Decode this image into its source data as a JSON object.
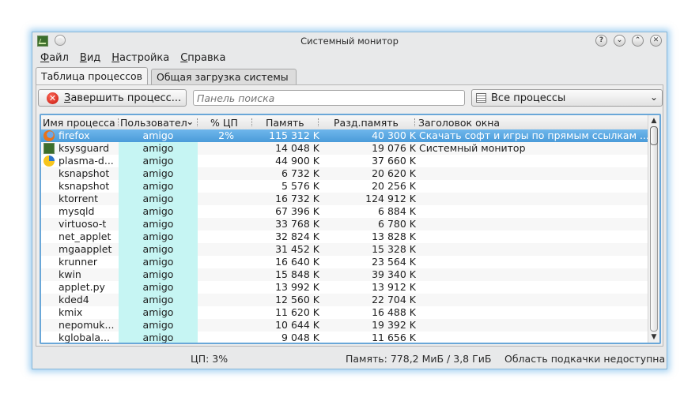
{
  "window": {
    "title": "Системный монитор",
    "buttons": [
      "?",
      "⌄",
      "⌃",
      "✕"
    ]
  },
  "menubar": [
    "Файл",
    "Вид",
    "Настройка",
    "Справка"
  ],
  "tabs": [
    {
      "label": "Таблица процессов",
      "active": true
    },
    {
      "label": "Общая загрузка системы",
      "active": false
    }
  ],
  "toolbar": {
    "kill_label": "Завершить процесс...",
    "search_placeholder": "Панель поиска",
    "filter_value": "Все процессы"
  },
  "table": {
    "columns": [
      "Имя процесса",
      "Пользовател",
      "% ЦП",
      "Память",
      "Разд.память",
      "Заголовок окна"
    ],
    "rows": [
      {
        "icon": "firefox-icon",
        "name": "firefox",
        "user": "amigo",
        "cpu": "2%",
        "mem": "115 312 K",
        "shared": "40 300 K",
        "title": "Скачать софт и игры по прямым ссылкам ..."
      },
      {
        "icon": "ksysguard-icon",
        "name": "ksysguard",
        "user": "amigo",
        "cpu": "",
        "mem": "14 048 K",
        "shared": "19 076 K",
        "title": "Системный монитор"
      },
      {
        "icon": "plasma-icon",
        "name": "plasma-d...",
        "user": "amigo",
        "cpu": "",
        "mem": "44 900 K",
        "shared": "37 660 K",
        "title": ""
      },
      {
        "icon": "",
        "name": "ksnapshot",
        "user": "amigo",
        "cpu": "",
        "mem": "6 732 K",
        "shared": "20 620 K",
        "title": ""
      },
      {
        "icon": "",
        "name": "ksnapshot",
        "user": "amigo",
        "cpu": "",
        "mem": "5 576 K",
        "shared": "20 256 K",
        "title": ""
      },
      {
        "icon": "",
        "name": "ktorrent",
        "user": "amigo",
        "cpu": "",
        "mem": "16 732 K",
        "shared": "124 912 K",
        "title": ""
      },
      {
        "icon": "",
        "name": "mysqld",
        "user": "amigo",
        "cpu": "",
        "mem": "67 396 K",
        "shared": "6 884 K",
        "title": ""
      },
      {
        "icon": "",
        "name": "virtuoso-t",
        "user": "amigo",
        "cpu": "",
        "mem": "33 768 K",
        "shared": "6 780 K",
        "title": ""
      },
      {
        "icon": "",
        "name": "net_applet",
        "user": "amigo",
        "cpu": "",
        "mem": "32 824 K",
        "shared": "13 828 K",
        "title": ""
      },
      {
        "icon": "",
        "name": "mgaapplet",
        "user": "amigo",
        "cpu": "",
        "mem": "31 452 K",
        "shared": "15 328 K",
        "title": ""
      },
      {
        "icon": "",
        "name": "krunner",
        "user": "amigo",
        "cpu": "",
        "mem": "16 640 K",
        "shared": "23 564 K",
        "title": ""
      },
      {
        "icon": "",
        "name": "kwin",
        "user": "amigo",
        "cpu": "",
        "mem": "15 848 K",
        "shared": "39 340 K",
        "title": ""
      },
      {
        "icon": "",
        "name": "applet.py",
        "user": "amigo",
        "cpu": "",
        "mem": "13 992 K",
        "shared": "13 912 K",
        "title": ""
      },
      {
        "icon": "",
        "name": "kded4",
        "user": "amigo",
        "cpu": "",
        "mem": "12 560 K",
        "shared": "22 704 K",
        "title": ""
      },
      {
        "icon": "",
        "name": "kmix",
        "user": "amigo",
        "cpu": "",
        "mem": "11 620 K",
        "shared": "16 488 K",
        "title": ""
      },
      {
        "icon": "",
        "name": "nepomuk...",
        "user": "amigo",
        "cpu": "",
        "mem": "10 644 K",
        "shared": "19 392 K",
        "title": ""
      },
      {
        "icon": "",
        "name": "kglobala...",
        "user": "amigo",
        "cpu": "",
        "mem": "9 048 K",
        "shared": "11 656 K",
        "title": ""
      }
    ]
  },
  "statusbar": {
    "cpu": "ЦП: 3%",
    "memory": "Память: 778,2 МиБ / 3,8 ГиБ",
    "swap": "Область подкачки недоступна"
  }
}
